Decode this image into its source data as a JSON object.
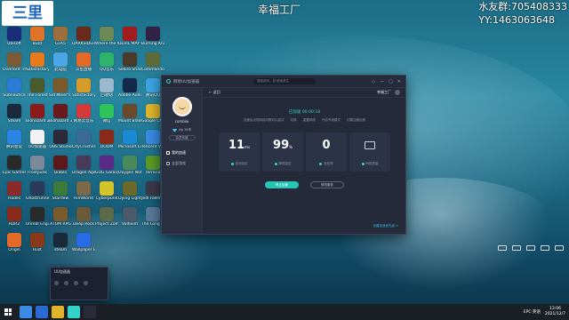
{
  "watermark": {
    "logo_text": "三里",
    "center": "幸福工厂",
    "group": "水友群:705408333",
    "qq": "YY:1463063648"
  },
  "desktop_icons": [
    {
      "label": "Ubisoft",
      "color": "#1b2d78"
    },
    {
      "label": "Buzz",
      "color": "#e0722a"
    },
    {
      "label": "GTA5",
      "color": "#9a6f3b"
    },
    {
      "label": "DARKSIDERS",
      "color": "#682a1a"
    },
    {
      "label": "Where the Water Ta..",
      "color": "#6c8a55"
    },
    {
      "label": "DEVIL MAY CRY 5",
      "color": "#a11c1c"
    },
    {
      "label": "Burning Knight",
      "color": "#2f2244"
    },
    {
      "label": "Overlord: Humanity",
      "color": "#7c5a34"
    },
    {
      "label": "Satisfactory",
      "color": "#e77a1a"
    },
    {
      "label": "此电脑",
      "color": "#4ca6e6"
    },
    {
      "label": "斗鱼直播",
      "color": "#e46a2a"
    },
    {
      "label": "QQ音乐",
      "color": "#2eb36a"
    },
    {
      "label": "Sekiro Shadows..",
      "color": "#4a3a2a"
    },
    {
      "label": "Commandos Behind Ene..",
      "color": "#5d6a3a"
    },
    {
      "label": "Subnautica",
      "color": "#2a7bd4"
    },
    {
      "label": "The Forest",
      "color": "#4a5a2a"
    },
    {
      "label": "Sid Meier's Civilization",
      "color": "#7a5a2a"
    },
    {
      "label": "Satisfactory Mod",
      "color": "#d49a2a"
    },
    {
      "label": "回收站",
      "color": "#9db8cc"
    },
    {
      "label": "Adobe Audition",
      "color": "#14284a"
    },
    {
      "label": "腾讯QQ",
      "color": "#3ca4e4"
    },
    {
      "label": "Steam",
      "color": "#1b2a3a"
    },
    {
      "label": "Biohazard 2",
      "color": "#8a1a1a"
    },
    {
      "label": "Biohazard 3",
      "color": "#6a1a1a"
    },
    {
      "label": "网易云音乐",
      "color": "#d43a3a"
    },
    {
      "label": "微信",
      "color": "#2ec35a"
    },
    {
      "label": "Mount Blade",
      "color": "#6a4a2a"
    },
    {
      "label": "Google Chrome",
      "color": "#e0b42a"
    },
    {
      "label": "腾讯会议",
      "color": "#2a84e4"
    },
    {
      "label": "UU加速器",
      "color": "#f2f2f2"
    },
    {
      "label": "OBS Studio",
      "color": "#2a2a3a"
    },
    {
      "label": "CityCrusher",
      "color": "#3a6a9a"
    },
    {
      "label": "DOOM",
      "color": "#8a2a1a"
    },
    {
      "label": "Microsoft Edge",
      "color": "#1a8ad4"
    },
    {
      "label": "Tencent Video",
      "color": "#3a8ae4"
    },
    {
      "label": "Epic Games",
      "color": "#2a2a2a"
    },
    {
      "label": "Frostpunk",
      "color": "#7a8a9a"
    },
    {
      "label": "Diablo",
      "color": "#5a1a1a"
    },
    {
      "label": "Dragon Age",
      "color": "#4a3a5a"
    },
    {
      "label": "GOG Galaxy",
      "color": "#5a2a8a"
    },
    {
      "label": "Oxygen Not..",
      "color": "#4a8a5a"
    },
    {
      "label": "Terraria",
      "color": "#5a9a2a"
    },
    {
      "label": "Hades",
      "color": "#8a2a2a"
    },
    {
      "label": "Ghostrunner",
      "color": "#2a3a5a"
    },
    {
      "label": "Stardew",
      "color": "#3a7a3a"
    },
    {
      "label": "RimWorld",
      "color": "#7a6a4a"
    },
    {
      "label": "Cyberpunk",
      "color": "#d4c42a"
    },
    {
      "label": "Dying Light",
      "color": "#6a6a2a"
    },
    {
      "label": "Jedi Fallen..",
      "color": "#3a3a4a"
    },
    {
      "label": "RDR2",
      "color": "#8a2a1a"
    },
    {
      "label": "Unreal Engine",
      "color": "#2a2a2a"
    },
    {
      "label": "ATOM RPG",
      "color": "#7a5a2a"
    },
    {
      "label": "Deep Rock",
      "color": "#6a5a3a"
    },
    {
      "label": "Project Zomboid",
      "color": "#5a6a4a"
    },
    {
      "label": "Valheim",
      "color": "#4a5a6a"
    },
    {
      "label": "The Long Dark",
      "color": "#5a7a9a"
    },
    {
      "label": "Origin",
      "color": "#e46a2a"
    },
    {
      "label": "Rust",
      "color": "#8a3a1a"
    },
    {
      "label": "steam",
      "color": "#1b2a3a"
    },
    {
      "label": "Wallpaper Engine",
      "color": "#2a6ae4"
    }
  ],
  "app": {
    "title": "网易UU加速器",
    "search_placeholder": "搜索游戏，如:绝地求生",
    "controls": [
      "◇",
      "—",
      "□",
      "✕"
    ],
    "user": {
      "name": "combiw",
      "vip": "vip Yk币",
      "recharge": "会员充值"
    },
    "nav": [
      {
        "label": "我的加速",
        "active": true
      },
      {
        "label": "全部游戏",
        "active": false
      }
    ],
    "back_label": "← 返回",
    "game_name": "幸福工厂",
    "status": "已加速 00:00:18",
    "hints": [
      "加速后出现网络问题可以尝试",
      "切换",
      "重置网络",
      "开启专线模式",
      "切换加速区服"
    ],
    "stats": [
      {
        "value": "11",
        "unit": "ms",
        "label": "游戏延迟",
        "has_monitor": false
      },
      {
        "value": "99",
        "unit": "%",
        "label": "降低延迟",
        "has_monitor": false
      },
      {
        "value": "0",
        "unit": "",
        "label": "丢包率",
        "has_monitor": false
      },
      {
        "value": "",
        "unit": "",
        "label": "网络质量",
        "has_monitor": true
      }
    ],
    "primary_button": "停止加速",
    "secondary_button": "修改服务",
    "footer_link": "设置加速优先级 >"
  },
  "mini_popup": {
    "title": "UU加速器"
  },
  "taskbar": {
    "tray_text": "EPC 英语",
    "time": "13:06",
    "date": "2021/12/7"
  }
}
